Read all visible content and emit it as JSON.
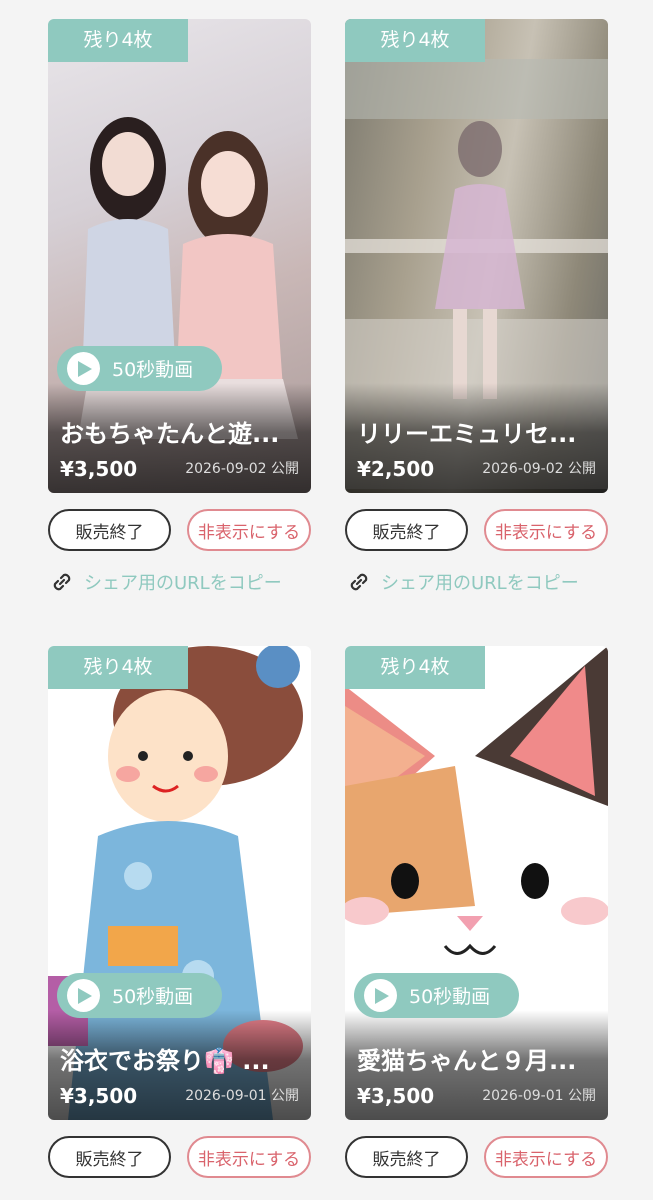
{
  "colors": {
    "accent": "#8fc9bf",
    "hide_button": "#d9636c",
    "end_button": "#333333"
  },
  "cards": [
    {
      "stock": "残り4枚",
      "video": "50秒動画",
      "title": "おもちゃたんと遊...",
      "price": "¥3,500",
      "date": "2026-09-02 公開",
      "end_label": "販売終了",
      "hide_label": "非表示にする",
      "share_label": "シェア用のURLをコピー"
    },
    {
      "stock": "残り4枚",
      "title": "リリーエミュリセ...",
      "price": "¥2,500",
      "date": "2026-09-02 公開",
      "end_label": "販売終了",
      "hide_label": "非表示にする",
      "share_label": "シェア用のURLをコピー"
    },
    {
      "stock": "残り4枚",
      "video": "50秒動画",
      "title": "浴衣でお祭り👘 ...",
      "price": "¥3,500",
      "date": "2026-09-01 公開",
      "end_label": "販売終了",
      "hide_label": "非表示にする"
    },
    {
      "stock": "残り4枚",
      "video": "50秒動画",
      "title": "愛猫ちゃんと９月...",
      "price": "¥3,500",
      "date": "2026-09-01 公開",
      "end_label": "販売終了",
      "hide_label": "非表示にする"
    }
  ]
}
